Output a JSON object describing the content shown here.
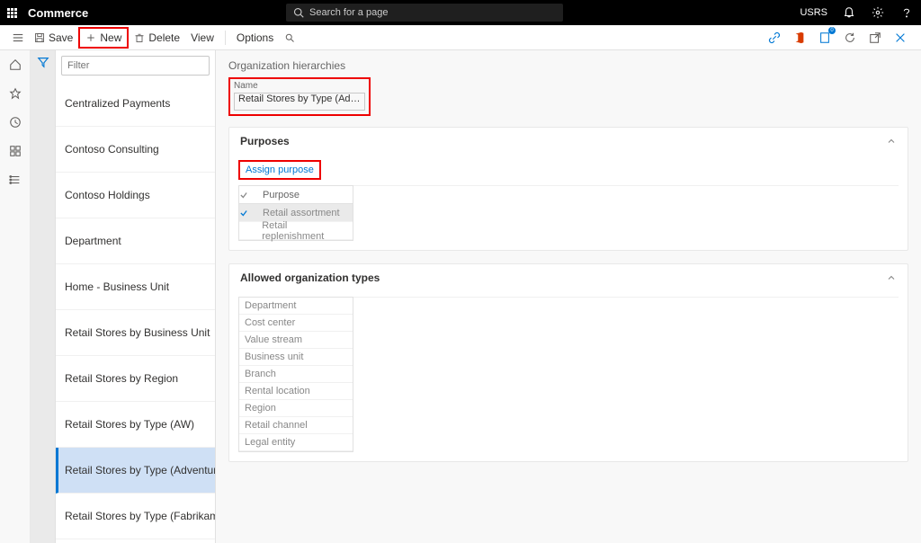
{
  "topbar": {
    "app_title": "Commerce",
    "search_placeholder": "Search for a page",
    "user": "USRS"
  },
  "cmdbar": {
    "save": "Save",
    "new": "New",
    "delete": "Delete",
    "view": "View",
    "options": "Options"
  },
  "filter": {
    "placeholder": "Filter"
  },
  "list": [
    "Centralized Payments",
    "Contoso Consulting",
    "Contoso Holdings",
    "Department",
    "Home - Business Unit",
    "Retail Stores by Business Unit",
    "Retail Stores by Region",
    "Retail Stores by Type (AW)",
    "Retail Stores by Type (Adventure Works)",
    "Retail Stores by Type (Fabrikam)"
  ],
  "list_selected_index": 8,
  "main": {
    "page_title": "Organization hierarchies",
    "name_label": "Name",
    "name_value": "Retail Stores by Type (Adventur...",
    "purposes": {
      "title": "Purposes",
      "assign_label": "Assign purpose",
      "column": "Purpose",
      "rows": [
        {
          "name": "Retail assortment",
          "selected": true
        },
        {
          "name": "Retail replenishment",
          "selected": false
        }
      ]
    },
    "allowed_types": {
      "title": "Allowed organization types",
      "rows": [
        "Department",
        "Cost center",
        "Value stream",
        "Business unit",
        "Branch",
        "Rental location",
        "Region",
        "Retail channel",
        "Legal entity"
      ]
    }
  }
}
